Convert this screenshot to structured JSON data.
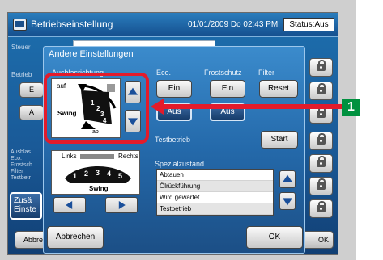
{
  "window": {
    "title": "Betriebseinstellung",
    "datetime": "01/01/2009 Do 02:43 PM",
    "status_label": "Status:Aus"
  },
  "background": {
    "steuer_label": "Steuer",
    "betrieb_label": "Betrieb",
    "button_e": "E",
    "button_a": "A",
    "side_info_lines": [
      "Ausblas",
      "Eco.",
      "Frostsch",
      "Filter",
      "Testbetr"
    ],
    "zusatz_button_lines": [
      "Zusä",
      "Einste"
    ],
    "abbrechen_button": "Abbre",
    "ok_button": "OK"
  },
  "dialog": {
    "title": "Andere Einstellungen",
    "sections": {
      "ausblasrichtung": "Ausblasrichtung",
      "eco": "Eco.",
      "frostschutz": "Frostschutz",
      "filter": "Filter",
      "testbetrieb": "Testbetrieb",
      "spezialzustand": "Spezialzustand"
    },
    "vertical_louver": {
      "top_label": "auf",
      "bottom_label": "ab",
      "mode_label": "Swing",
      "positions": [
        "1",
        "2",
        "3",
        "4"
      ]
    },
    "horizontal_louver": {
      "left_label": "Links",
      "right_label": "Rechts",
      "mode_label": "Swing",
      "positions": [
        "1",
        "2",
        "3",
        "4",
        "5"
      ]
    },
    "eco": {
      "on": "Ein",
      "off": "Aus"
    },
    "frostschutz": {
      "on": "Ein",
      "off": "Aus"
    },
    "filter": {
      "reset": "Reset"
    },
    "testbetrieb": {
      "start": "Start"
    },
    "spezialzustand_items": [
      "Abtauen",
      "Ölrückführung",
      "Wird gewartet",
      "Testbetrieb"
    ],
    "cancel_button": "Abbrechen",
    "ok_button": "OK"
  },
  "annotation": {
    "badge": "1",
    "color": "#e31b2b",
    "badge_color": "#00913f"
  }
}
